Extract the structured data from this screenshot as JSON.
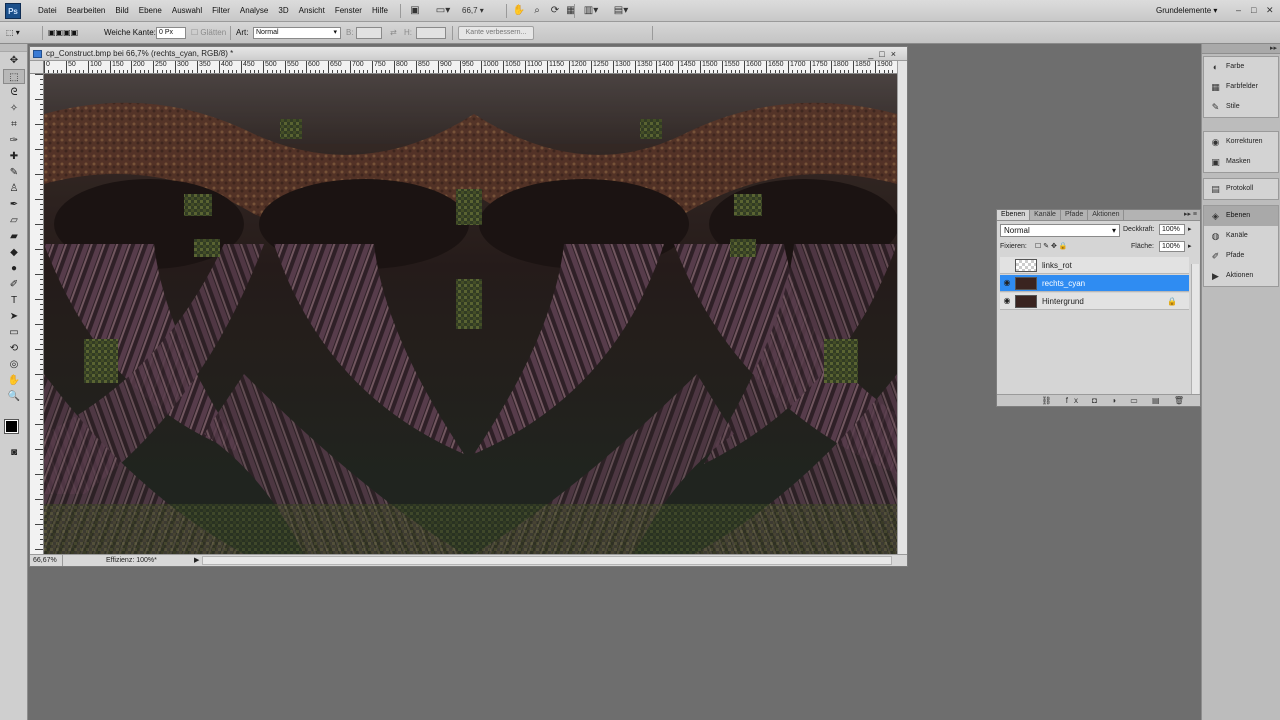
{
  "app": {
    "logo": "Ps",
    "menu": [
      "Datei",
      "Bearbeiten",
      "Bild",
      "Ebene",
      "Auswahl",
      "Filter",
      "Analyse",
      "3D",
      "Ansicht",
      "Fenster",
      "Hilfe"
    ],
    "zoom_level": "66,7",
    "workspace": "Grundelemente",
    "window_controls": [
      "–",
      "□",
      "✕"
    ]
  },
  "options_bar": {
    "soft_edge_label": "Weiche Kante:",
    "soft_edge_value": "0 Px",
    "smooth_label": "Glätten",
    "style_label": "Art:",
    "style_value": "Normal",
    "width_label": "B:",
    "height_label": "H:",
    "refine_edge_button": "Kante verbessern..."
  },
  "document": {
    "title": "cp_Construct.bmp bei 66,7% (rechts_cyan, RGB/8) *",
    "controls": [
      "_",
      "□",
      "×"
    ],
    "ruler_labels": [
      "0",
      "50",
      "100",
      "150",
      "200",
      "250",
      "300",
      "350",
      "400",
      "450",
      "500",
      "550",
      "600",
      "650",
      "700",
      "750",
      "800",
      "850",
      "900",
      "950",
      "1000",
      "1050",
      "1100",
      "1150",
      "1200",
      "1250",
      "1300",
      "1350",
      "1400",
      "1450",
      "1500",
      "1550",
      "1600",
      "1650",
      "1700",
      "1750",
      "1800",
      "1850",
      "1900"
    ],
    "status_zoom": "66,67%",
    "status_info": "Effizienz: 100%*"
  },
  "layers_panel": {
    "tabs": [
      "Ebenen",
      "Kanäle",
      "Pfade",
      "Aktionen"
    ],
    "blend_mode": "Normal",
    "opacity_label": "Deckkraft:",
    "opacity_value": "100%",
    "lock_label": "Fixieren:",
    "fill_label": "Fläche:",
    "fill_value": "100%",
    "layers": [
      {
        "name": "links_rot",
        "visible": false,
        "selected": false,
        "locked": false
      },
      {
        "name": "rechts_cyan",
        "visible": true,
        "selected": true,
        "locked": false
      },
      {
        "name": "Hintergrund",
        "visible": true,
        "selected": false,
        "locked": true
      }
    ],
    "bottom_icons": "⛓ fx ◘ ◑ ▭ ▤ 🗑"
  },
  "dock": {
    "groups": [
      {
        "items": [
          {
            "label": "Farbe",
            "icon": "color-icon",
            "glyph": "◐"
          },
          {
            "label": "Farbfelder",
            "icon": "swatches-icon",
            "glyph": "▦"
          },
          {
            "label": "Stile",
            "icon": "styles-icon",
            "glyph": "✎"
          }
        ]
      },
      {
        "items": [
          {
            "label": "Korrekturen",
            "icon": "adjustments-icon",
            "glyph": "◉"
          },
          {
            "label": "Masken",
            "icon": "masks-icon",
            "glyph": "▣"
          }
        ]
      },
      {
        "items": [
          {
            "label": "Protokoll",
            "icon": "history-icon",
            "glyph": "▤"
          }
        ]
      },
      {
        "items": [
          {
            "label": "Ebenen",
            "icon": "layers-icon",
            "glyph": "◈",
            "active": true
          },
          {
            "label": "Kanäle",
            "icon": "channels-icon",
            "glyph": "◍"
          },
          {
            "label": "Pfade",
            "icon": "paths-icon",
            "glyph": "✐"
          },
          {
            "label": "Aktionen",
            "icon": "actions-icon",
            "glyph": "▶"
          }
        ]
      }
    ]
  },
  "tools": [
    {
      "name": "move-tool-icon",
      "glyph": "✥"
    },
    {
      "name": "marquee-tool-icon",
      "glyph": "⬚",
      "active": true
    },
    {
      "name": "lasso-tool-icon",
      "glyph": "ᘓ"
    },
    {
      "name": "quick-selection-tool-icon",
      "glyph": "✧"
    },
    {
      "name": "crop-tool-icon",
      "glyph": "⌗"
    },
    {
      "name": "eyedropper-tool-icon",
      "glyph": "✑"
    },
    {
      "name": "spot-healing-tool-icon",
      "glyph": "✚"
    },
    {
      "name": "brush-tool-icon",
      "glyph": "✎"
    },
    {
      "name": "clone-stamp-tool-icon",
      "glyph": "♙"
    },
    {
      "name": "history-brush-tool-icon",
      "glyph": "✒"
    },
    {
      "name": "eraser-tool-icon",
      "glyph": "▱"
    },
    {
      "name": "gradient-tool-icon",
      "glyph": "▰"
    },
    {
      "name": "blur-tool-icon",
      "glyph": "◆"
    },
    {
      "name": "dodge-tool-icon",
      "glyph": "●"
    },
    {
      "name": "pen-tool-icon",
      "glyph": "✐"
    },
    {
      "name": "type-tool-icon",
      "glyph": "T"
    },
    {
      "name": "path-selection-tool-icon",
      "glyph": "➤"
    },
    {
      "name": "shape-tool-icon",
      "glyph": "▭"
    },
    {
      "name": "3d-rotate-tool-icon",
      "glyph": "⟲"
    },
    {
      "name": "3d-orbit-tool-icon",
      "glyph": "◎"
    },
    {
      "name": "hand-tool-icon",
      "glyph": "✋"
    },
    {
      "name": "zoom-tool-icon",
      "glyph": "🔍"
    }
  ],
  "colors": {
    "foreground": "#000000",
    "background": "#ffffff",
    "selection": "#2f8cf2"
  }
}
